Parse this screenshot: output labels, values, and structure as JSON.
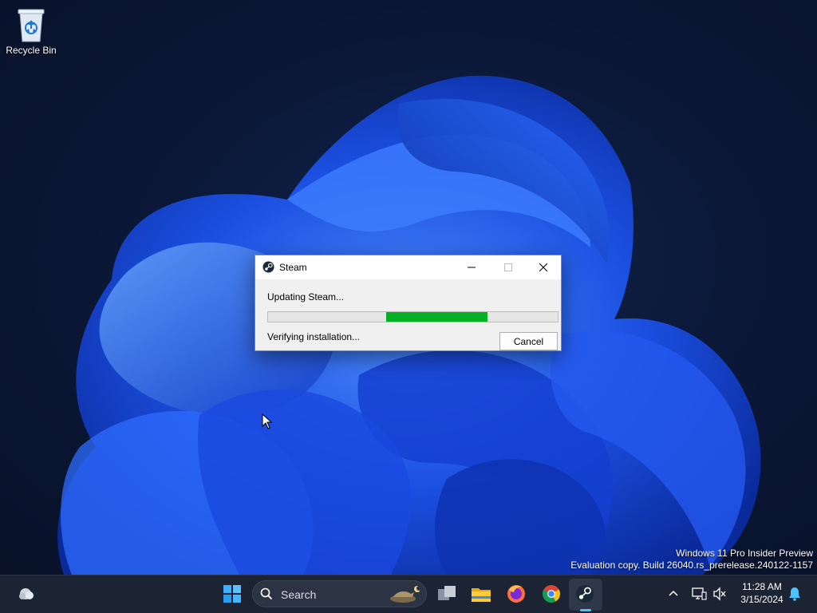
{
  "desktop": {
    "icons": [
      {
        "label": "Recycle Bin",
        "icon": "recycle-bin-icon"
      }
    ],
    "watermark": {
      "line1": "Windows 11 Pro Insider Preview",
      "line2": "Evaluation copy. Build 26040.rs_prerelease.240122-1157"
    }
  },
  "dialog": {
    "title": "Steam",
    "icon": "steam-icon",
    "status": "Updating Steam...",
    "detail": "Verifying installation...",
    "cancel_label": "Cancel",
    "progress": {
      "start_fraction": 0.408,
      "end_fraction": 0.757,
      "color": "#06b025"
    }
  },
  "taskbar": {
    "search_placeholder": "Search",
    "apps": [
      "weather-icon",
      "windows-start-icon",
      "task-view-icon",
      "file-explorer-icon",
      "firefox-icon",
      "chrome-icon",
      "steam-icon"
    ],
    "active_app": "steam-icon",
    "clock": {
      "time": "11:28 AM",
      "date": "3/15/2024"
    },
    "accent": "#4cc2ff"
  }
}
